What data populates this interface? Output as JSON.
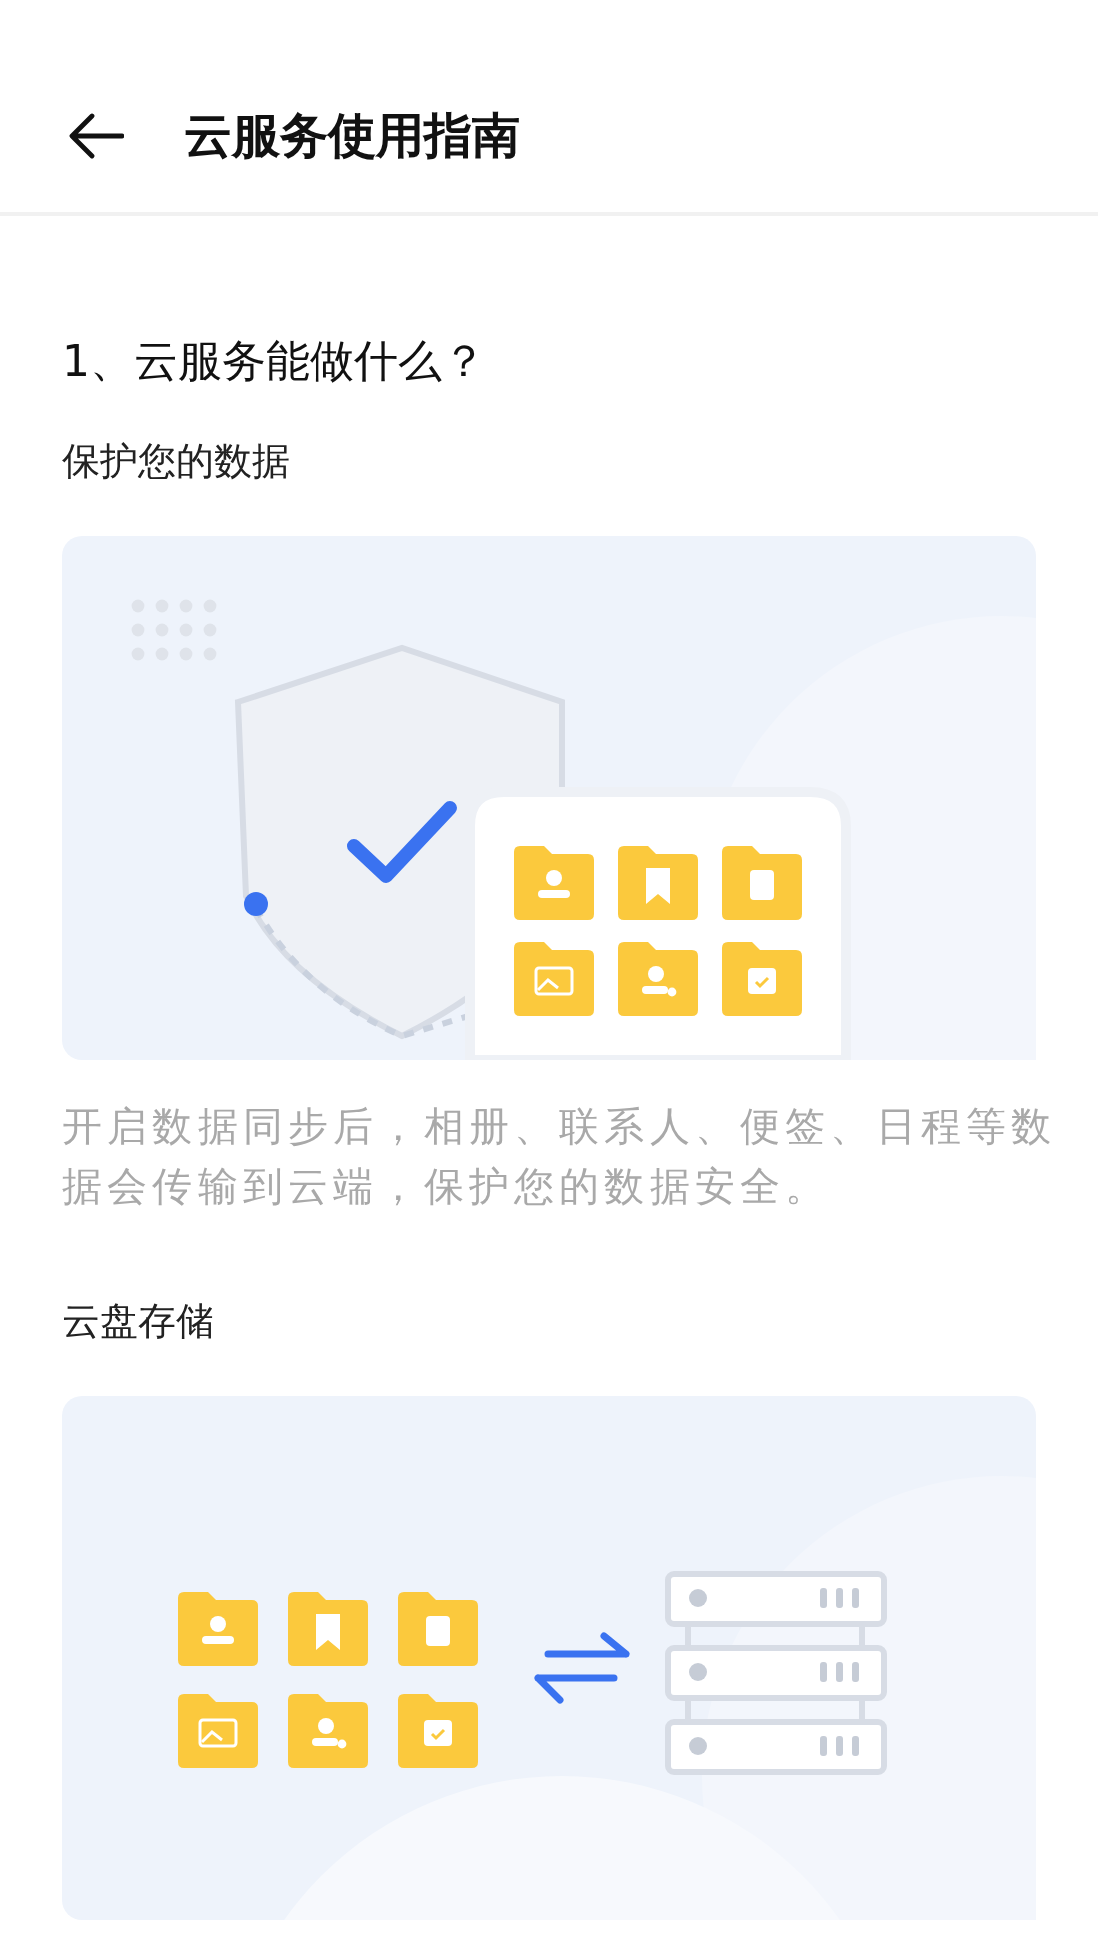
{
  "header": {
    "title": "云服务使用指南"
  },
  "section": {
    "heading": "1、云服务能做什么？",
    "items": [
      {
        "subtitle": "保护您的数据",
        "illustration": {
          "kind": "protect"
        },
        "description": "开启数据同步后，相册、联系人、便签、日程等数据会传输到云端，保护您的数据安全。"
      },
      {
        "subtitle": "云盘存储",
        "illustration": {
          "kind": "storage"
        }
      }
    ]
  }
}
